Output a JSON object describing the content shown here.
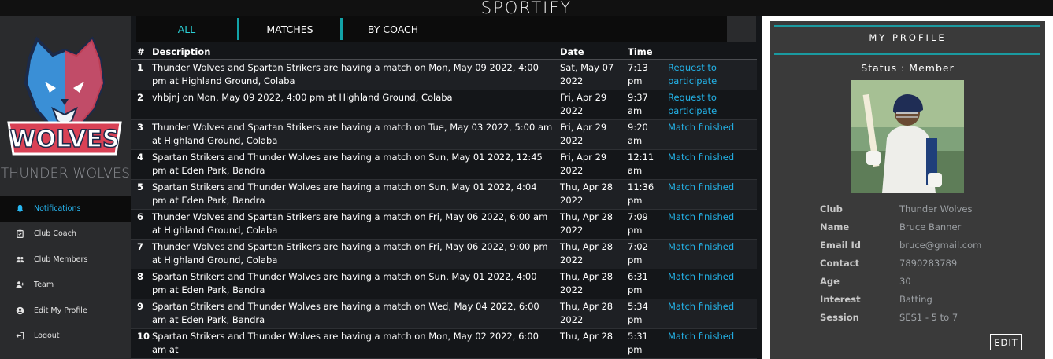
{
  "app": {
    "title": "SPORTIFY"
  },
  "sidebar": {
    "team_name": "THUNDER WOLVES",
    "logo_text": "WOLVES",
    "items": [
      {
        "label": "Notifications",
        "icon": "bell-icon",
        "active": true
      },
      {
        "label": "Club Coach",
        "icon": "clipboard-icon",
        "active": false
      },
      {
        "label": "Club Members",
        "icon": "group-icon",
        "active": false
      },
      {
        "label": "Team",
        "icon": "person-add-icon",
        "active": false
      },
      {
        "label": "Edit My Profile",
        "icon": "user-circle-icon",
        "active": false
      },
      {
        "label": "Logout",
        "icon": "logout-icon",
        "active": false
      }
    ]
  },
  "tabs": [
    {
      "label": "ALL"
    },
    {
      "label": "MATCHES"
    },
    {
      "label": "BY COACH"
    }
  ],
  "table": {
    "headers": [
      "#",
      "Description",
      "Date",
      "Time",
      ""
    ],
    "rows": [
      {
        "num": "1",
        "description": "Thunder Wolves and Spartan Strikers are having a match on Mon, May 09 2022, 4:00 pm at Highland Ground, Colaba",
        "date": "Sat, May 07 2022",
        "time": "7:13 pm",
        "status": "Request to participate"
      },
      {
        "num": "2",
        "description": "vhbjnj on Mon, May 09 2022, 4:00 pm at Highland Ground, Colaba",
        "date": "Fri, Apr 29 2022",
        "time": "9:37 am",
        "status": "Request to participate"
      },
      {
        "num": "3",
        "description": "Thunder Wolves and Spartan Strikers are having a match on Tue, May 03 2022, 5:00 am at Highland Ground, Colaba",
        "date": "Fri, Apr 29 2022",
        "time": "9:20 am",
        "status": "Match finished"
      },
      {
        "num": "4",
        "description": "Spartan Strikers and Thunder Wolves are having a match on Sun, May 01 2022, 12:45 pm at Eden Park, Bandra",
        "date": "Fri, Apr 29 2022",
        "time": "12:11 am",
        "status": "Match finished"
      },
      {
        "num": "5",
        "description": "Spartan Strikers and Thunder Wolves are having a match on Sun, May 01 2022, 4:04 pm at Eden Park, Bandra",
        "date": "Thu, Apr 28 2022",
        "time": "11:36 pm",
        "status": "Match finished"
      },
      {
        "num": "6",
        "description": "Thunder Wolves and Spartan Strikers are having a match on Fri, May 06 2022, 6:00 am at Highland Ground, Colaba",
        "date": "Thu, Apr 28 2022",
        "time": "7:09 pm",
        "status": "Match finished"
      },
      {
        "num": "7",
        "description": "Thunder Wolves and Spartan Strikers are having a match on Fri, May 06 2022, 9:00 pm at Highland Ground, Colaba",
        "date": "Thu, Apr 28 2022",
        "time": "7:02 pm",
        "status": "Match finished"
      },
      {
        "num": "8",
        "description": "Spartan Strikers and Thunder Wolves are having a match on Sun, May 01 2022, 4:00 pm at Eden Park, Bandra",
        "date": "Thu, Apr 28 2022",
        "time": "6:31 pm",
        "status": "Match finished"
      },
      {
        "num": "9",
        "description": "Spartan Strikers and Thunder Wolves are having a match on Wed, May 04 2022, 6:00 am at Eden Park, Bandra",
        "date": "Thu, Apr 28 2022",
        "time": "5:34 pm",
        "status": "Match finished"
      },
      {
        "num": "10",
        "description": "Spartan Strikers and Thunder Wolves are having a match on Mon, May 02 2022, 6:00 am at",
        "date": "Thu, Apr 28",
        "time": "5:31 pm",
        "status": "Match finished"
      }
    ]
  },
  "profile": {
    "heading": "MY PROFILE",
    "status": "Status : Member",
    "fields": [
      {
        "label": "Club",
        "value": "Thunder Wolves"
      },
      {
        "label": "Name",
        "value": "Bruce Banner"
      },
      {
        "label": "Email Id",
        "value": "bruce@gmail.com"
      },
      {
        "label": "Contact",
        "value": "7890283789"
      },
      {
        "label": "Age",
        "value": "30"
      },
      {
        "label": "Interest",
        "value": "Batting"
      },
      {
        "label": "Session",
        "value": "SES1 - 5 to 7"
      }
    ],
    "edit_label": "EDIT"
  },
  "colors": {
    "accent_teal": "#1a9aa0",
    "link_blue": "#23b3e8",
    "active_nav": "#27b7f2"
  }
}
